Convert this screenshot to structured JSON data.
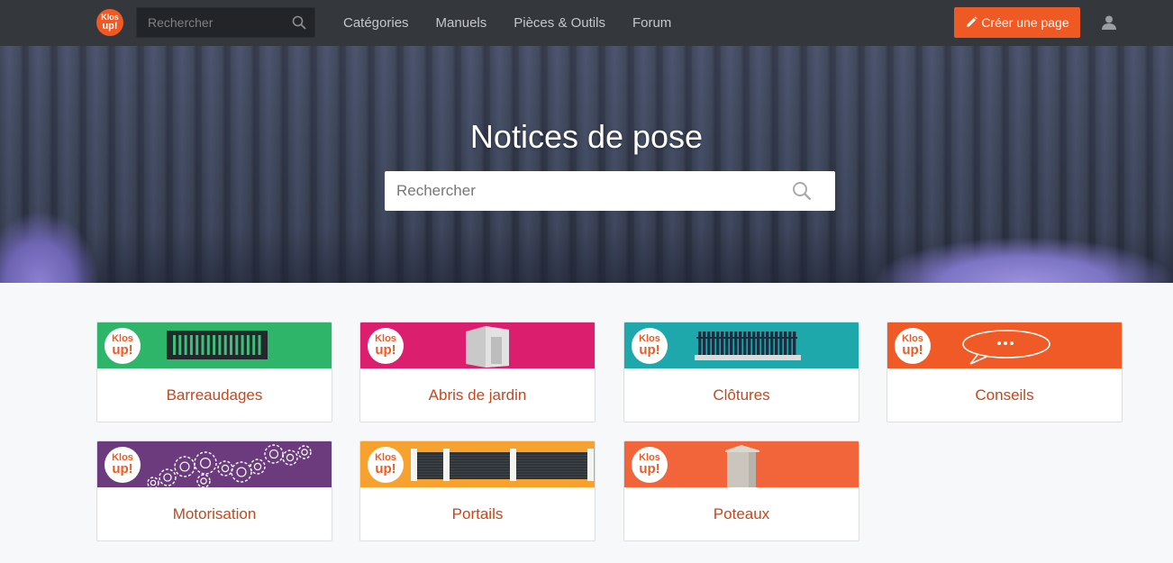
{
  "nav": {
    "logo_line1": "Klos",
    "logo_line2": "up!",
    "search_placeholder": "Rechercher",
    "links": [
      "Catégories",
      "Manuels",
      "Pièces & Outils",
      "Forum"
    ],
    "create_label": "Créer une page"
  },
  "hero": {
    "title": "Notices de pose",
    "search_placeholder": "Rechercher"
  },
  "colors": {
    "brand": "#ef5a24",
    "nav_bg": "#34373b"
  },
  "cards": [
    {
      "label": "Barreaudages",
      "band_color": "#2fb56a",
      "icon": "gate-bars-icon"
    },
    {
      "label": "Abris de jardin",
      "band_color": "#db1f6e",
      "icon": "garden-shed-icon"
    },
    {
      "label": "Clôtures",
      "band_color": "#1ea8ab",
      "icon": "fence-icon"
    },
    {
      "label": "Conseils",
      "band_color": "#f05a27",
      "icon": "speech-bubble-icon"
    },
    {
      "label": "Motorisation",
      "band_color": "#6b3b7e",
      "icon": "gears-icon"
    },
    {
      "label": "Portails",
      "band_color": "#f7a12f",
      "icon": "gate-icon"
    },
    {
      "label": "Poteaux",
      "band_color": "#f2643a",
      "icon": "post-icon"
    }
  ],
  "badge": {
    "line1": "Klos",
    "line2": "up!"
  }
}
